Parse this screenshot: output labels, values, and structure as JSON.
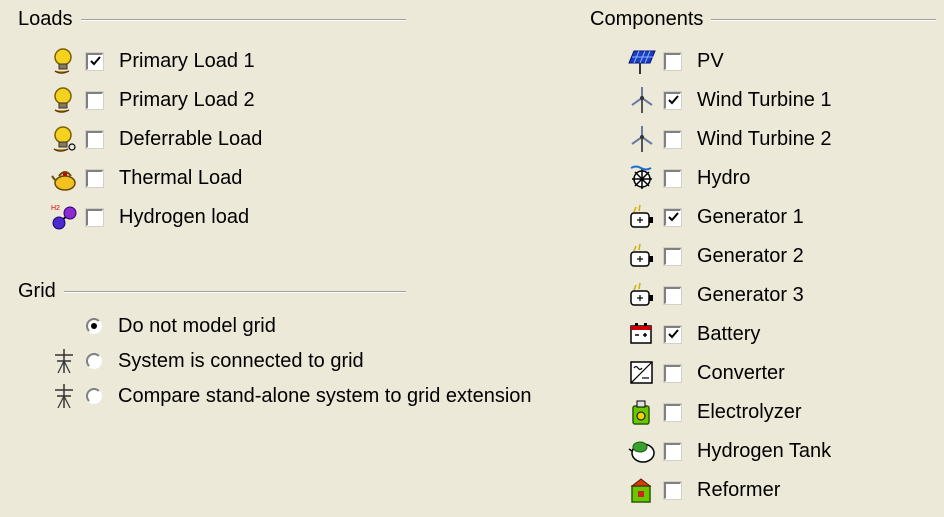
{
  "loads": {
    "title": "Loads",
    "items": [
      {
        "label": "Primary Load 1",
        "checked": true,
        "icon": "bulb-icon"
      },
      {
        "label": "Primary Load 2",
        "checked": false,
        "icon": "bulb-icon"
      },
      {
        "label": "Deferrable Load",
        "checked": false,
        "icon": "deferrable-bulb-icon"
      },
      {
        "label": "Thermal Load",
        "checked": false,
        "icon": "kettle-icon"
      },
      {
        "label": "Hydrogen load",
        "checked": false,
        "icon": "hydrogen-molecule-icon"
      }
    ]
  },
  "grid": {
    "title": "Grid",
    "options": [
      {
        "label": "Do not model grid",
        "selected": true,
        "icon": ""
      },
      {
        "label": "System is connected to grid",
        "selected": false,
        "icon": "power-pylon-icon"
      },
      {
        "label": "Compare stand-alone system to grid extension",
        "selected": false,
        "icon": "power-pylon-icon"
      }
    ]
  },
  "components": {
    "title": "Components",
    "items": [
      {
        "label": "PV",
        "checked": false,
        "icon": "solar-panel-icon"
      },
      {
        "label": "Wind Turbine 1",
        "checked": true,
        "icon": "wind-turbine-icon"
      },
      {
        "label": "Wind Turbine 2",
        "checked": false,
        "icon": "wind-turbine-icon"
      },
      {
        "label": "Hydro",
        "checked": false,
        "icon": "hydro-wheel-icon"
      },
      {
        "label": "Generator 1",
        "checked": true,
        "icon": "generator-icon"
      },
      {
        "label": "Generator 2",
        "checked": false,
        "icon": "generator-icon"
      },
      {
        "label": "Generator 3",
        "checked": false,
        "icon": "generator-icon"
      },
      {
        "label": "Battery",
        "checked": true,
        "icon": "battery-icon"
      },
      {
        "label": "Converter",
        "checked": false,
        "icon": "converter-icon"
      },
      {
        "label": "Electrolyzer",
        "checked": false,
        "icon": "electrolyzer-icon"
      },
      {
        "label": "Hydrogen Tank",
        "checked": false,
        "icon": "hydrogen-tank-icon"
      },
      {
        "label": "Reformer",
        "checked": false,
        "icon": "reformer-icon"
      }
    ]
  }
}
